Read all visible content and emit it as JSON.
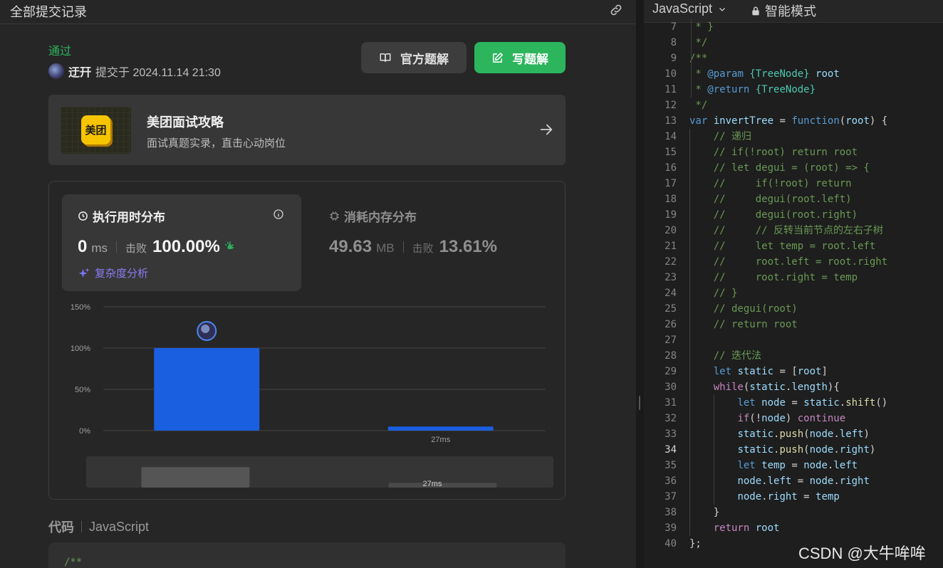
{
  "left_header": {
    "title": "全部提交记录",
    "link_icon": "link-icon"
  },
  "submission": {
    "status": "通过",
    "author": "迂幵",
    "submitted_at": "提交于 2024.11.14 21:30"
  },
  "buttons": {
    "official": "官方题解",
    "write": "写题解"
  },
  "promo": {
    "title": "美团面试攻略",
    "subtitle": "面试真题实录，直击心动岗位",
    "logo_text": "美团"
  },
  "runtime": {
    "title": "执行用时分布",
    "value": "0",
    "unit": "ms",
    "beat_label": "击败",
    "beat_value": "100.00%",
    "complexity_link": "复杂度分析"
  },
  "memory": {
    "title": "消耗内存分布",
    "value": "49.63",
    "unit": "MB",
    "beat_label": "击败",
    "beat_value": "13.61%"
  },
  "chart_data": {
    "type": "bar",
    "y_ticks": [
      "150%",
      "100%",
      "50%",
      "0%"
    ],
    "ylim": [
      0,
      150
    ],
    "bars": [
      {
        "label": "",
        "value": 100,
        "mine": true
      },
      {
        "label": "27ms",
        "value": 5,
        "mine": false
      }
    ],
    "navigator_label": "27ms",
    "colors": {
      "bar": "#1a5fe0",
      "grid": "#444444"
    }
  },
  "code_section": {
    "label": "代码",
    "language": "JavaScript",
    "preview_first_line": "/**"
  },
  "editor": {
    "language": "JavaScript",
    "mode": "智能模式",
    "active_line": 34,
    "lines": [
      {
        "n": "7",
        "text": " * }"
      },
      {
        "n": "8",
        "text": " */"
      },
      {
        "n": "9",
        "text": "/**"
      },
      {
        "n": "10",
        "text": " * @param {TreeNode} root"
      },
      {
        "n": "11",
        "text": " * @return {TreeNode}"
      },
      {
        "n": "12",
        "text": " */"
      },
      {
        "n": "13",
        "text": "var invertTree = function(root) {"
      },
      {
        "n": "14",
        "text": "    // 递归"
      },
      {
        "n": "15",
        "text": "    // if(!root) return root"
      },
      {
        "n": "16",
        "text": "    // let degui = (root) => {"
      },
      {
        "n": "17",
        "text": "    //     if(!root) return"
      },
      {
        "n": "18",
        "text": "    //     degui(root.left)"
      },
      {
        "n": "19",
        "text": "    //     degui(root.right)"
      },
      {
        "n": "20",
        "text": "    //     // 反转当前节点的左右子树"
      },
      {
        "n": "21",
        "text": "    //     let temp = root.left"
      },
      {
        "n": "22",
        "text": "    //     root.left = root.right"
      },
      {
        "n": "23",
        "text": "    //     root.right = temp"
      },
      {
        "n": "24",
        "text": "    // }"
      },
      {
        "n": "25",
        "text": "    // degui(root)"
      },
      {
        "n": "26",
        "text": "    // return root"
      },
      {
        "n": "27",
        "text": ""
      },
      {
        "n": "28",
        "text": "    // 迭代法"
      },
      {
        "n": "29",
        "text": "    let static = [root]"
      },
      {
        "n": "30",
        "text": "    while(static.length){"
      },
      {
        "n": "31",
        "text": "        let node = static.shift()"
      },
      {
        "n": "32",
        "text": "        if(!node) continue"
      },
      {
        "n": "33",
        "text": "        static.push(node.left)"
      },
      {
        "n": "34",
        "text": "        static.push(node.right)"
      },
      {
        "n": "35",
        "text": "        let temp = node.left"
      },
      {
        "n": "36",
        "text": "        node.left = node.right"
      },
      {
        "n": "37",
        "text": "        node.right = temp"
      },
      {
        "n": "38",
        "text": "    }"
      },
      {
        "n": "39",
        "text": "    return root"
      },
      {
        "n": "40",
        "text": "};"
      }
    ]
  },
  "watermark": "CSDN @大牛哞哞"
}
